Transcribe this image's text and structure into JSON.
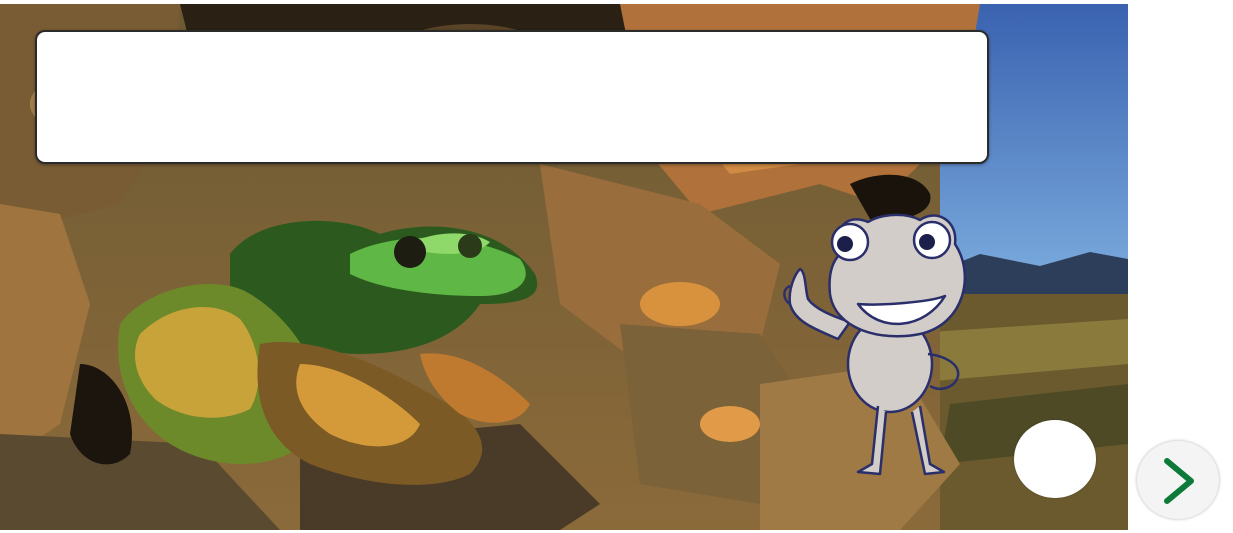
{
  "dialog": {
    "text": ""
  },
  "controls": {
    "next_icon": "chevron-right-icon",
    "next_color": "#0e7a3a",
    "round_button_color": "#ffffff"
  },
  "colors": {
    "sky": "#3f6fb8",
    "rock_dark": "#3a2a18",
    "rock_mid": "#8a6232",
    "rock_light": "#c08a4a",
    "frog_green": "#5fb845",
    "cartoon_frog_body": "#cfcac6",
    "cartoon_frog_outline": "#2a2f6b"
  }
}
